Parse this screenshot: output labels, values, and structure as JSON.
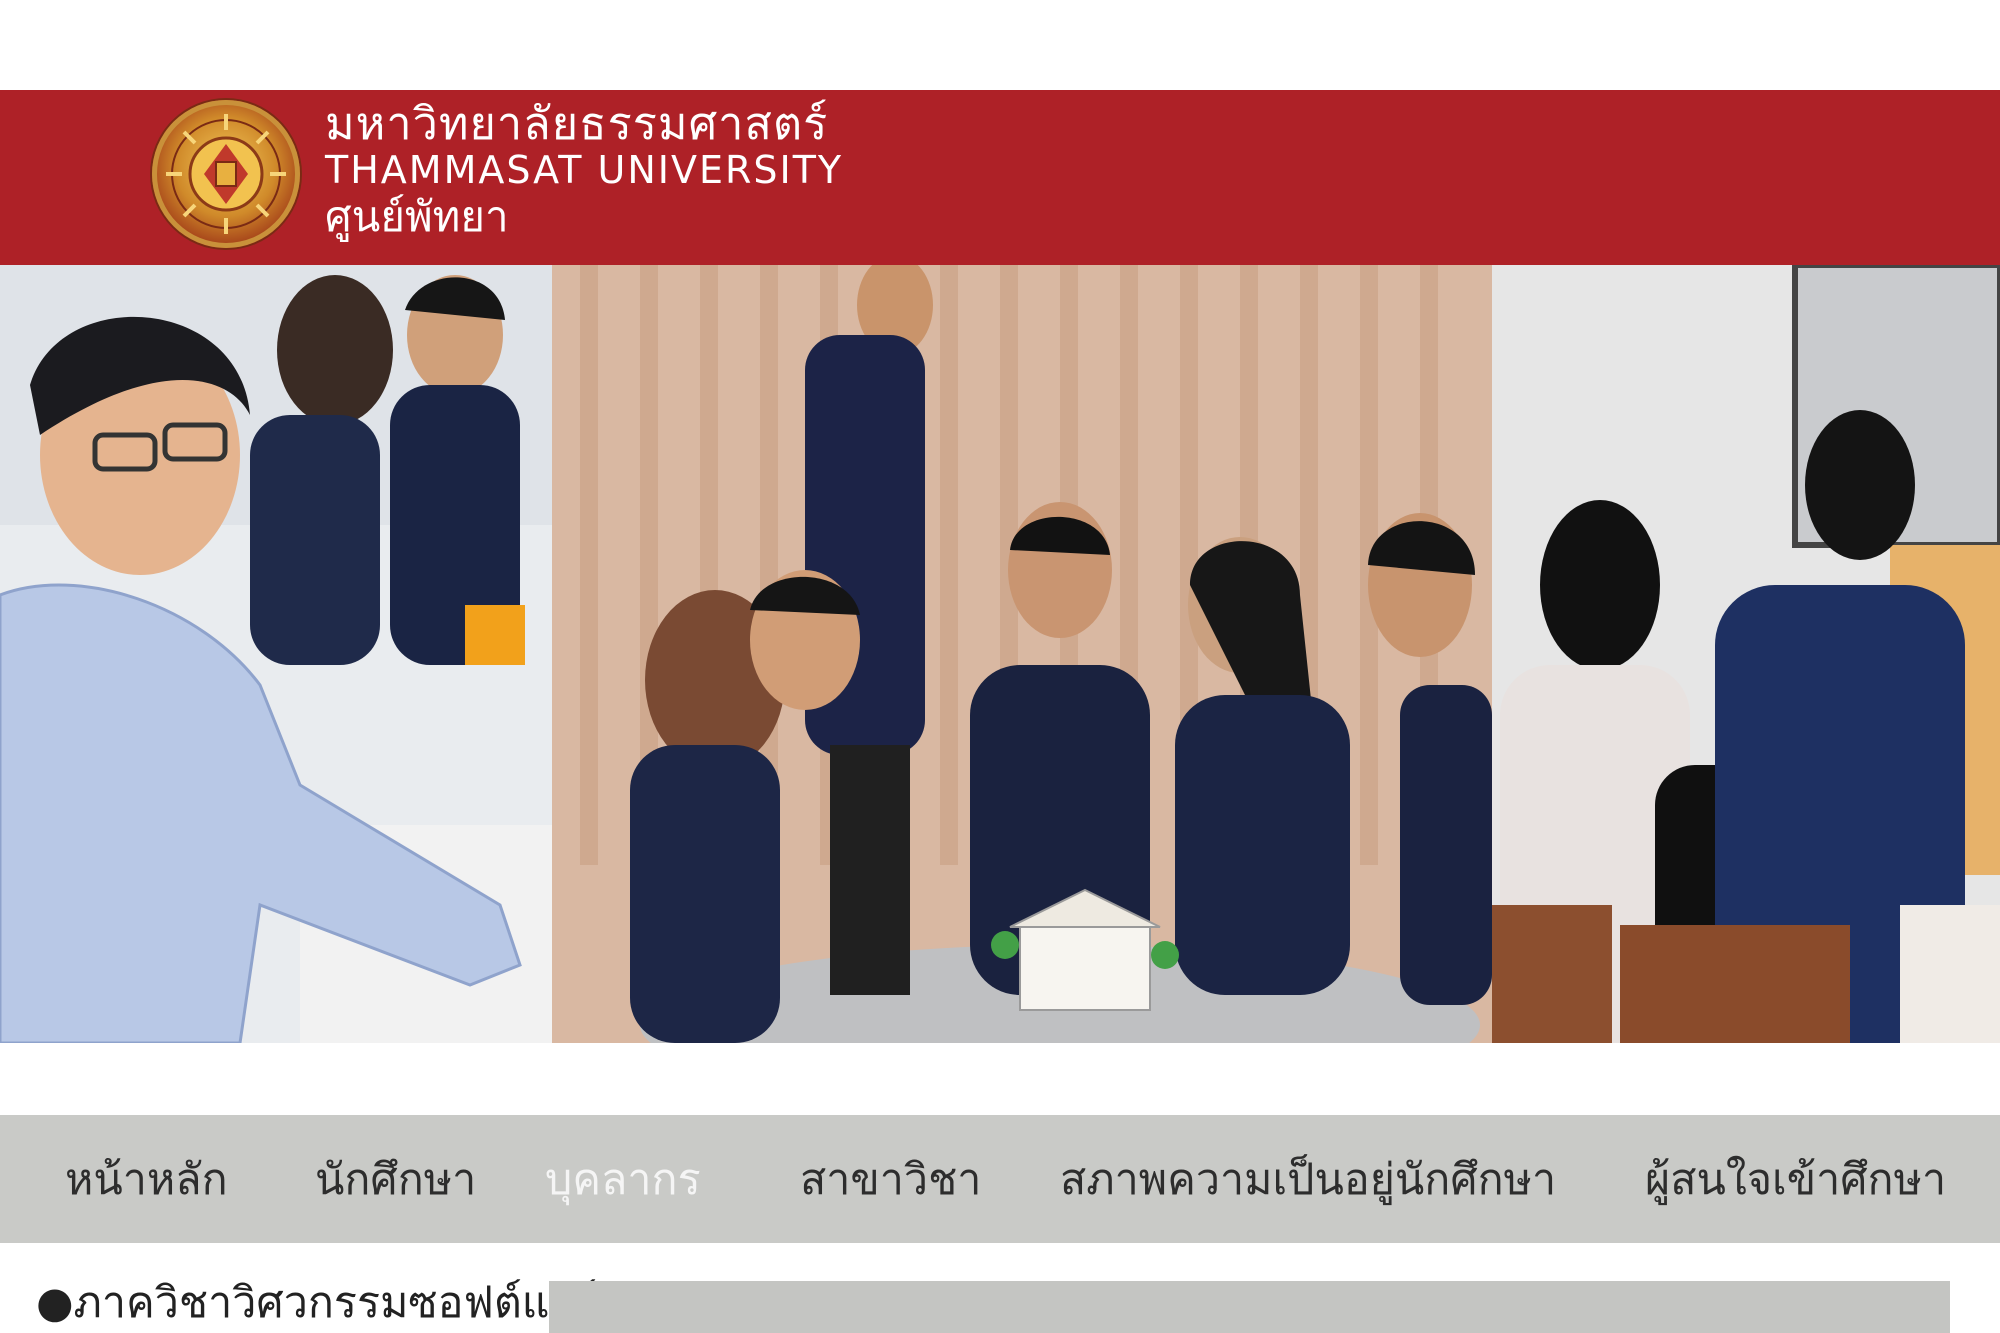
{
  "header": {
    "university_th": "มหาวิทยาลัยธรรมศาสตร์",
    "university_en": "THAMMASAT UNIVERSITY",
    "campus": "ศูนย์พัทยา",
    "logo_ring_text_top": "มหาวิทยาลัยธรรมศาสตร์",
    "logo_ring_text_bottom": "THAMMASAT UNIVERSITY"
  },
  "nav": {
    "items": [
      {
        "label": "หน้าหลัก",
        "active": false
      },
      {
        "label": "นักศึกษา",
        "active": false
      },
      {
        "label": "บุคลากร",
        "active": true
      },
      {
        "label": "สาขาวิชา",
        "active": false
      },
      {
        "label": "สภาพความเป็นอยู่นักศึกษา",
        "active": false
      },
      {
        "label": "ผู้สนใจเข้าศึกษา",
        "active": false
      }
    ]
  },
  "section": {
    "heading": "●ภาควิชาวิศวกรรมซอฟต์แวร์"
  },
  "colors": {
    "header_red": "#ae2127",
    "nav_gray": "#c9cac7",
    "active_nav_text": "#f5f5f5"
  }
}
